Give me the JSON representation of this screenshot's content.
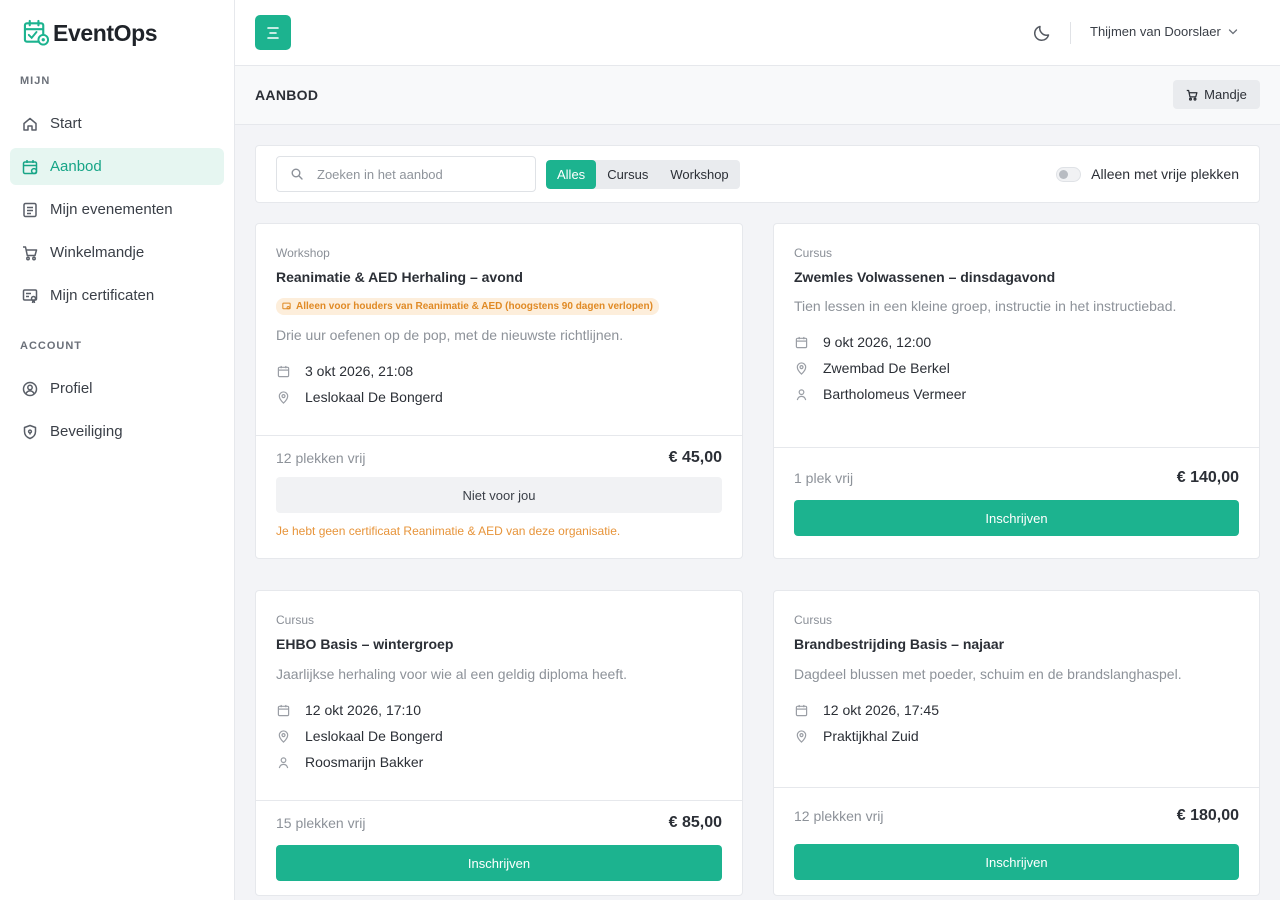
{
  "app": {
    "name": "EventOps"
  },
  "sidebar": {
    "sections": [
      {
        "label": "MIJN"
      },
      {
        "label": "ACCOUNT"
      }
    ],
    "items": [
      {
        "label": "Start",
        "icon": "home-icon"
      },
      {
        "label": "Aanbod",
        "icon": "calendar-check-icon",
        "active": true
      },
      {
        "label": "Mijn evenementen",
        "icon": "list-icon"
      },
      {
        "label": "Winkelmandje",
        "icon": "cart-icon"
      },
      {
        "label": "Mijn certificaten",
        "icon": "certificate-icon"
      },
      {
        "label": "Profiel",
        "icon": "user-circle-icon"
      },
      {
        "label": "Beveiliging",
        "icon": "shield-icon"
      }
    ]
  },
  "topbar": {
    "user": "Thijmen van Doorslaer"
  },
  "page": {
    "title": "AANBOD",
    "cart_label": "Mandje"
  },
  "filters": {
    "search_placeholder": "Zoeken in het aanbod",
    "search_value": "",
    "types": [
      "Alles",
      "Cursus",
      "Workshop"
    ],
    "selected_type": "Alles",
    "only_free_label": "Alleen met vrije plekken",
    "only_free": false
  },
  "colors": {
    "accent": "#1cb38f",
    "warning": "#e08a25"
  },
  "events": [
    {
      "kind": "Workshop",
      "title": "Reanimatie & AED Herhaling – avond",
      "badge": "Alleen voor houders van Reanimatie & AED (hoogstens 90 dagen verlopen)",
      "description": "Drie uur oefenen op de pop, met de nieuwste richtlijnen.",
      "date": "3 okt 2026, 21:08",
      "location": "Leslokaal De Bongerd",
      "spots": "12 plekken vrij",
      "price": "€ 45,00",
      "button": "Niet voor jou",
      "warning": "Je hebt geen certificaat Reanimatie & AED van deze organisatie."
    },
    {
      "kind": "Cursus",
      "title": "Zwemles Volwassenen – dinsdagavond",
      "description": "Tien lessen in een kleine groep, instructie in het instructiebad.",
      "date": "9 okt 2026, 12:00",
      "location": "Zwembad De Berkel",
      "instructor": "Bartholomeus Vermeer",
      "spots": "1 plek vrij",
      "price": "€ 140,00",
      "button": "Inschrijven"
    },
    {
      "kind": "Cursus",
      "title": "EHBO Basis – wintergroep",
      "description": "Jaarlijkse herhaling voor wie al een geldig diploma heeft.",
      "date": "12 okt 2026, 17:10",
      "location": "Leslokaal De Bongerd",
      "instructor": "Roosmarijn Bakker",
      "spots": "15 plekken vrij",
      "price": "€ 85,00",
      "button": "Inschrijven"
    },
    {
      "kind": "Cursus",
      "title": "Brandbestrijding Basis – najaar",
      "description": "Dagdeel blussen met poeder, schuim en de brandslanghaspel.",
      "date": "12 okt 2026, 17:45",
      "location": "Praktijkhal Zuid",
      "spots": "12 plekken vrij",
      "price": "€ 180,00",
      "button": "Inschrijven"
    }
  ]
}
